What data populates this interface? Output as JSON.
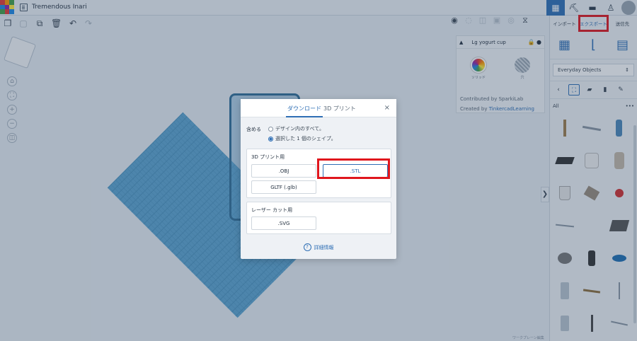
{
  "app": {
    "doc_title": "Tremendous Inari",
    "logo_colors": [
      "#e53935",
      "#ff9800",
      "#ffeb3b",
      "#43a047",
      "#1e88e5",
      "#8e24aa",
      "#e53935",
      "#43a047",
      "#1e88e5"
    ]
  },
  "sidebar": {
    "tabs": [
      {
        "label": "インポート"
      },
      {
        "label": "エクスポート"
      },
      {
        "label": "送信先"
      }
    ],
    "category_select": "Everyday Objects",
    "all_label": "All",
    "more": "•••",
    "collapse_glyph": "❯"
  },
  "shape_panel": {
    "name": "Lg yogurt cup",
    "solid_label": "ソリッド",
    "hole_label": "穴",
    "contributed_prefix": "Contributed by SparkiLab",
    "created_by": "Created by ",
    "created_link": "TinkercadLearning"
  },
  "dialog": {
    "tabs": [
      {
        "label": "ダウンロード"
      },
      {
        "label": "3D プリント"
      }
    ],
    "close": "×",
    "include_label": "含める",
    "options": [
      {
        "label": "デザイン内のすべて。"
      },
      {
        "label": "選択した 1 個のシェイプ。"
      }
    ],
    "print_section": "3D プリント用",
    "formats": [
      {
        "label": ".OBJ"
      },
      {
        "label": ".STL"
      },
      {
        "label": "GLTF (.glb)"
      }
    ],
    "laser_section": "レーザー カット用",
    "svg_label": ".SVG",
    "learn_more": "詳細情報",
    "help_glyph": "?"
  },
  "footer": {
    "text": "ワークプレーン編集"
  },
  "colors": {
    "accent": "#2f6fb5",
    "highlight": "#e0161d",
    "workplane": "#5ea6d1"
  }
}
